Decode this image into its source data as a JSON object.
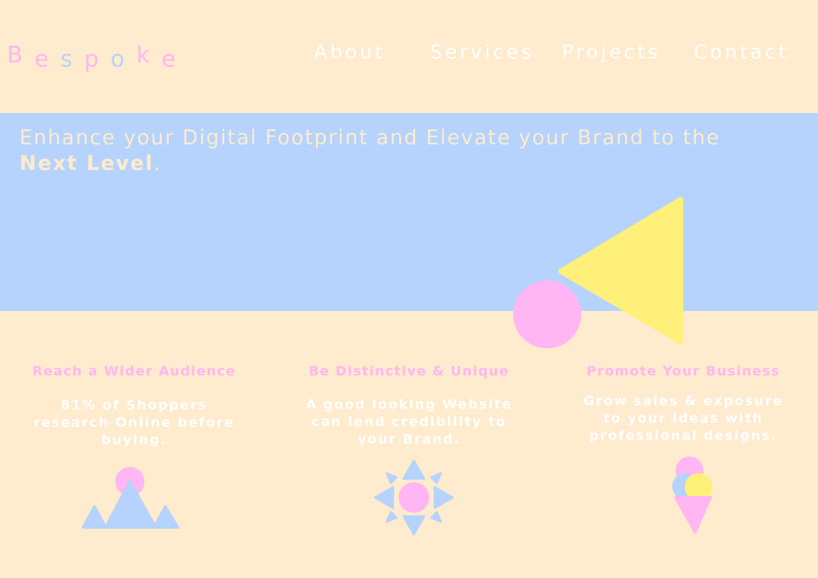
{
  "header": {
    "logo_letters": [
      "B",
      "e",
      "s",
      "p",
      "o",
      "k",
      "e"
    ],
    "nav": {
      "about": "About",
      "services": "Services",
      "projects": "Projects",
      "contact": "Contact"
    }
  },
  "hero": {
    "headline_prefix": "Enhance your Digital Footprint and Elevate your Brand to the ",
    "headline_emphasis": "Next Level",
    "headline_suffix": "."
  },
  "features": [
    {
      "title": "Reach a Wider Audience",
      "description": "81% of Shoppers research Online before buying.",
      "icon": "mountains-icon"
    },
    {
      "title": "Be Distinctive & Unique",
      "description": "A good looking Website can lend credibility to your Brand.",
      "icon": "sun-icon"
    },
    {
      "title": "Promote Your Business",
      "description": "Grow sales & exposure to your ideas with professional designs.",
      "icon": "ice-cream-icon"
    }
  ],
  "colors": {
    "background": "#FFEBCD",
    "hero_band": "#B5D3FC",
    "pink": "#FFB6F2",
    "yellow": "#FFF07A",
    "white": "#FFFFFF"
  }
}
